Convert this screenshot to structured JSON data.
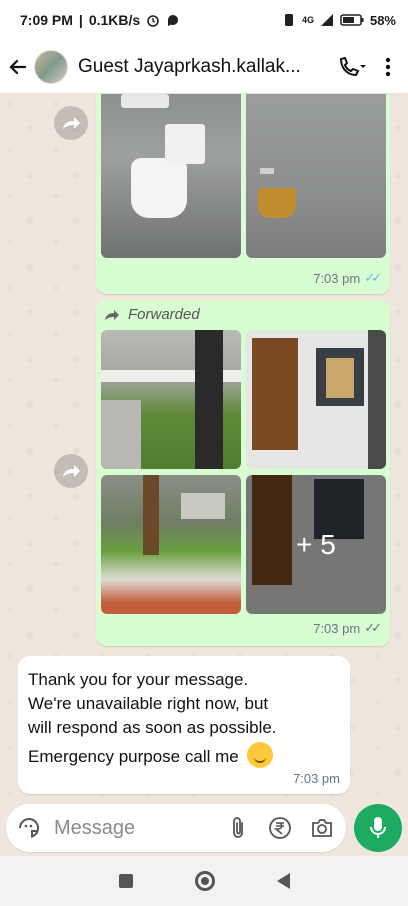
{
  "status_bar": {
    "time": "7:09 PM",
    "network_speed": "0.1KB/s",
    "network_type": "4G",
    "battery": "58%"
  },
  "header": {
    "contact_name": "Guest Jayaprkash.kallak...",
    "icons": [
      "back-arrow-icon",
      "call-icon",
      "more-options-icon"
    ]
  },
  "messages": {
    "first_album": {
      "time": "7:03 pm",
      "status": "read"
    },
    "second_album": {
      "forwarded_label": "Forwarded",
      "more_count": "+ 5",
      "time": "7:03 pm",
      "status": "delivered"
    },
    "incoming": {
      "line1": "Thank you for your message.",
      "line2": "We're unavailable right now, but",
      "line3": "will respond as soon as possible.",
      "line4": "Emergency purpose call me",
      "time": "7:03 pm"
    }
  },
  "composer": {
    "placeholder": "Message",
    "icons": [
      "sticker-icon",
      "attach-icon",
      "rupee-payment-icon",
      "camera-icon",
      "mic-icon"
    ]
  },
  "colors": {
    "outgoing_bubble": "#d9fdd3",
    "incoming_bubble": "#ffffff",
    "read_ticks": "#53bdeb",
    "mic_button": "#1daa61",
    "chat_background": "#efe7dd"
  }
}
